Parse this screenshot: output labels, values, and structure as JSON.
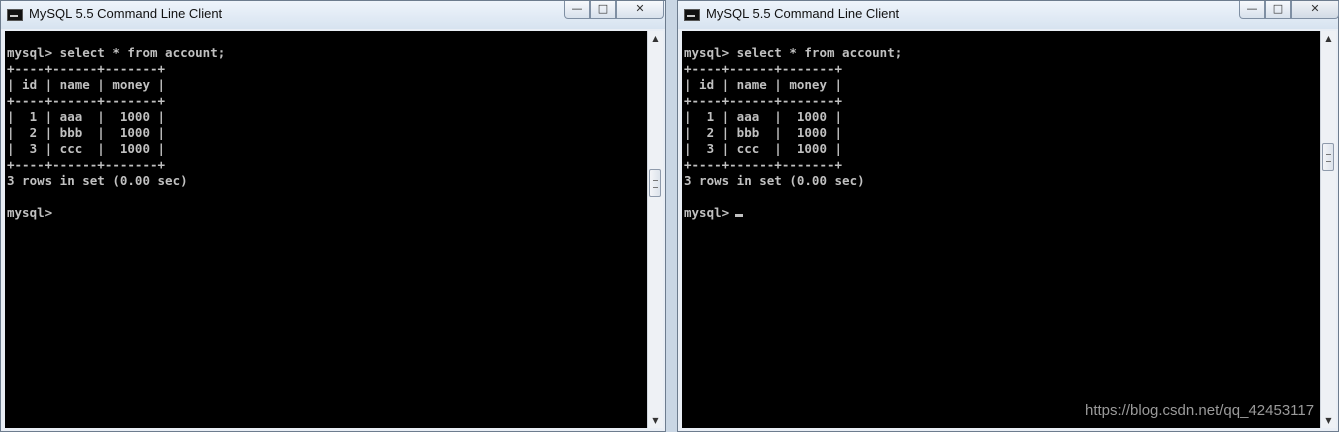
{
  "windows": {
    "left": {
      "title": "MySQL 5.5 Command Line Client",
      "console_text": "mysql> select * from account;\n+----+------+-------+\n| id | name | money |\n+----+------+-------+\n|  1 | aaa  |  1000 |\n|  2 | bbb  |  1000 |\n|  3 | ccc  |  1000 |\n+----+------+-------+\n3 rows in set (0.00 sec)\n\nmysql>"
    },
    "right": {
      "title": "MySQL 5.5 Command Line Client",
      "console_text": "mysql> select * from account;\n+----+------+-------+\n| id | name | money |\n+----+------+-------+\n|  1 | aaa  |  1000 |\n|  2 | bbb  |  1000 |\n|  3 | ccc  |  1000 |\n+----+------+-------+\n3 rows in set (0.00 sec)\n\nmysql>"
    }
  },
  "controls": {
    "minimize": "—",
    "maximize": "□",
    "close": "✕"
  },
  "icons": {
    "app": "console-icon",
    "scroll_up": "▲",
    "scroll_down": "▼"
  },
  "watermark": "https://blog.csdn.net/qq_42453117"
}
